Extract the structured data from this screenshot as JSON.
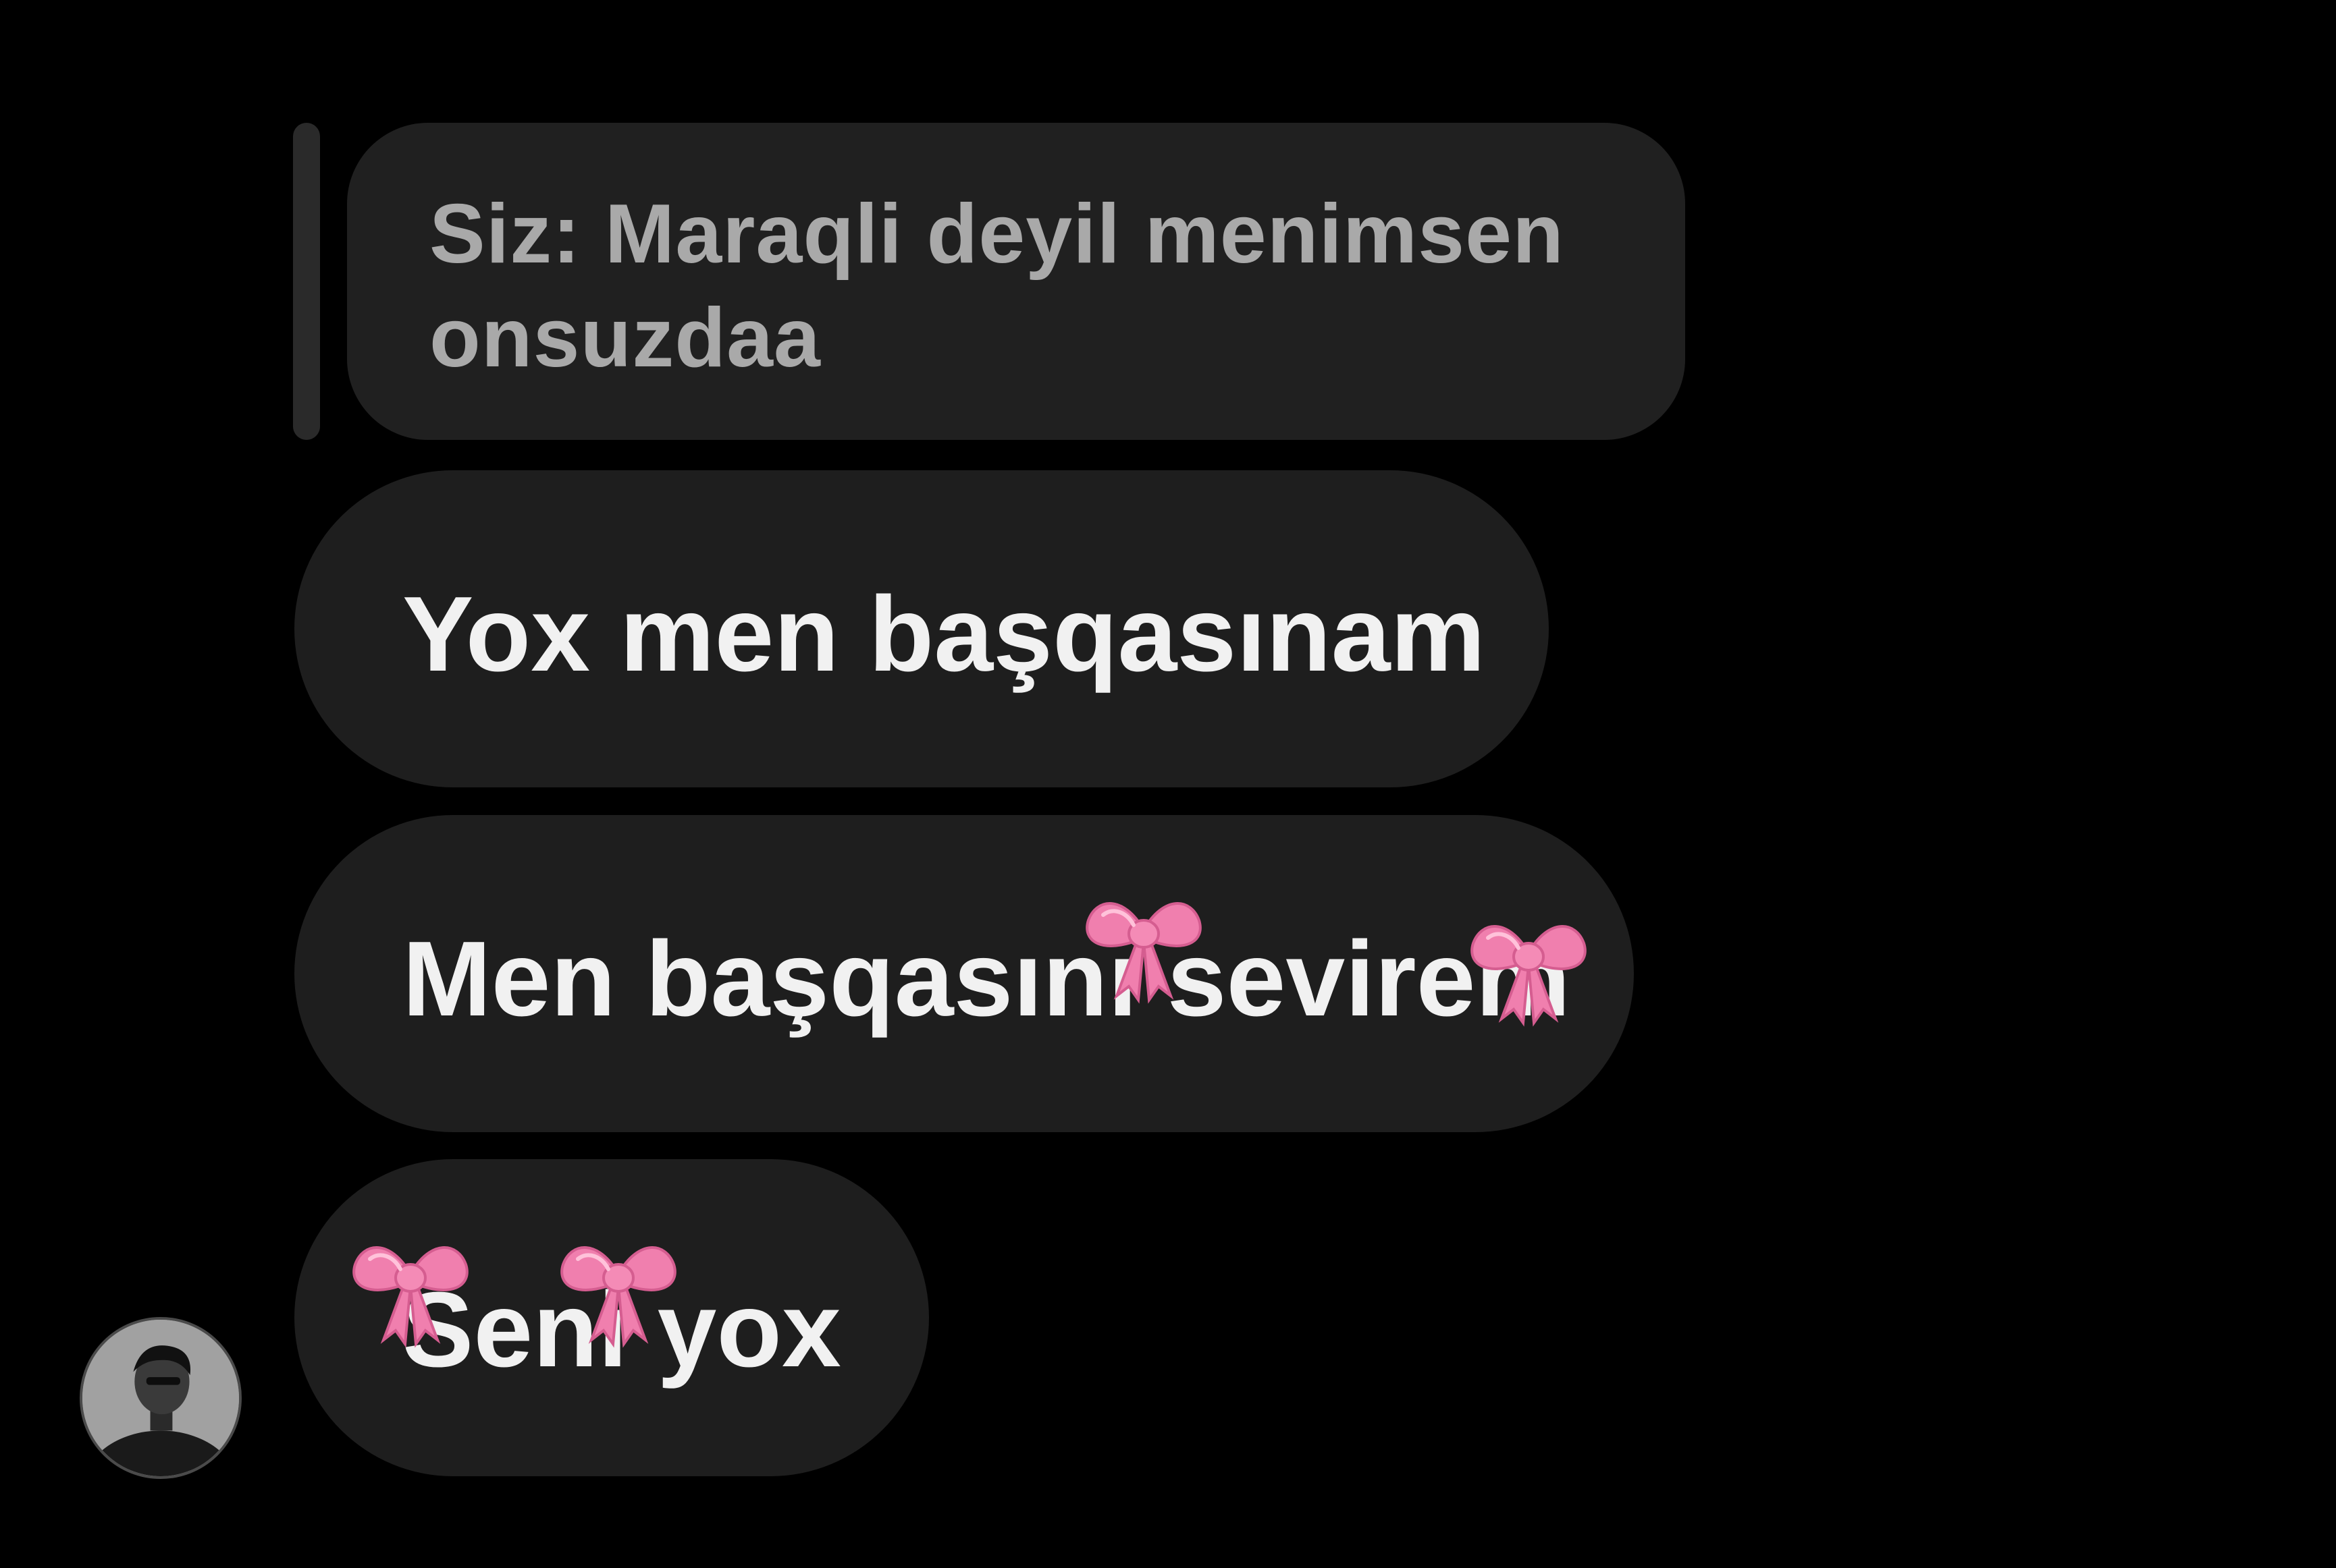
{
  "reply": {
    "prefix": "Siz:",
    "text": "Maraqli deyil menimsen onsuzdaa"
  },
  "messages": [
    {
      "text": "Yox men başqasınam"
    },
    {
      "text": "Men başqasını sevirem"
    },
    {
      "text": "Seni yox"
    }
  ],
  "stickers": [
    {
      "icon": "pink-bow-icon"
    },
    {
      "icon": "pink-bow-icon"
    },
    {
      "icon": "pink-bow-icon"
    },
    {
      "icon": "pink-bow-icon"
    }
  ],
  "colors": {
    "background": "#000000",
    "bubble": "#1e1e1e",
    "reply_bubble": "#202020",
    "reply_text": "#a9a9a9",
    "message_text": "#f1f1f1",
    "bow": "#f07fae"
  }
}
